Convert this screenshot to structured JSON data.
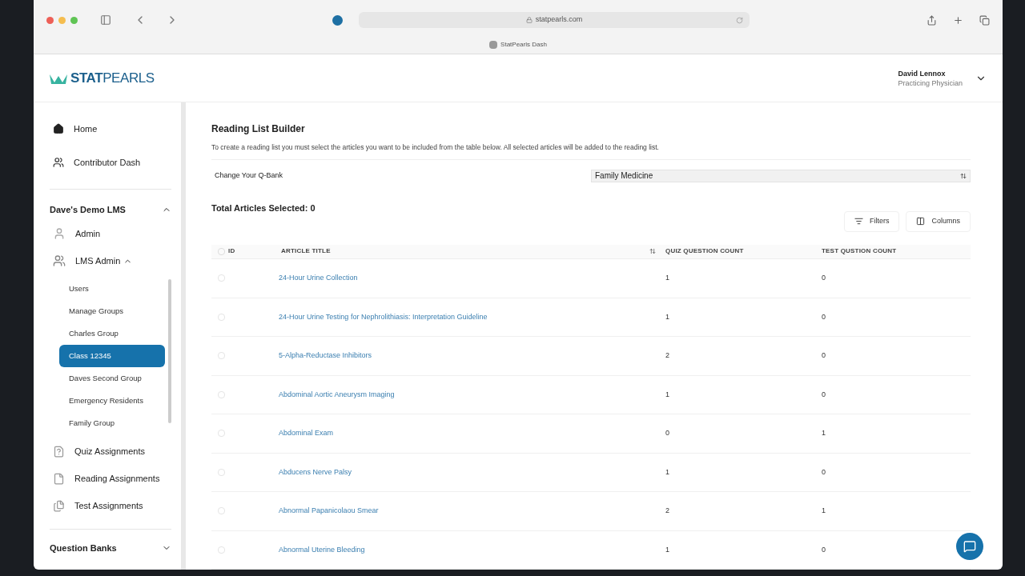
{
  "browser": {
    "address": "statpearls.com",
    "tab_title": "StatPearls Dash"
  },
  "header": {
    "logo_bold": "STAT",
    "logo_light": "PEARLS",
    "user_name": "David Lennox",
    "user_role": "Practicing Physician"
  },
  "sidebar": {
    "top_items": [
      {
        "label": "Home"
      },
      {
        "label": "Contributor Dash"
      }
    ],
    "section": {
      "title": "Dave's Demo LMS",
      "expanded": true,
      "items": [
        {
          "label": "Admin"
        },
        {
          "label": "LMS Admin",
          "expanded": true,
          "children": [
            {
              "label": "Users",
              "selected": false
            },
            {
              "label": "Manage Groups",
              "selected": false
            },
            {
              "label": "Charles Group",
              "selected": false
            },
            {
              "label": "Class 12345",
              "selected": true
            },
            {
              "label": "Daves Second Group",
              "selected": false
            },
            {
              "label": "Emergency Residents",
              "selected": false
            },
            {
              "label": "Family Group",
              "selected": false
            }
          ]
        },
        {
          "label": "Quiz Assignments"
        },
        {
          "label": "Reading Assignments"
        },
        {
          "label": "Test Assignments"
        }
      ]
    },
    "bottom_section": {
      "title": "Question Banks",
      "expanded": false
    }
  },
  "main": {
    "title": "Reading List Builder",
    "description": "To create a reading list you must select the articles you want to be included from the table below. All selected articles will be added to the reading list.",
    "qbank_label": "Change Your Q-Bank",
    "qbank_value": "Family Medicine",
    "total_selected": "Total Articles Selected: 0",
    "buttons": [
      "Filters",
      "Columns"
    ],
    "table": {
      "all_checked": false,
      "columns": [
        "ID",
        "ARTICLE TITLE",
        "QUIZ QUESTION COUNT",
        "TEST QUSTION COUNT"
      ],
      "rows": [
        {
          "checked": false,
          "title": "24-Hour Urine Collection",
          "quiz": "1",
          "test": "0"
        },
        {
          "checked": false,
          "title": "24-Hour Urine Testing for Nephrolithiasis: Interpretation Guideline",
          "quiz": "1",
          "test": "0"
        },
        {
          "checked": false,
          "title": "5-Alpha-Reductase Inhibitors",
          "quiz": "2",
          "test": "0"
        },
        {
          "checked": false,
          "title": "Abdominal Aortic Aneurysm Imaging",
          "quiz": "1",
          "test": "0"
        },
        {
          "checked": false,
          "title": "Abdominal Exam",
          "quiz": "0",
          "test": "1"
        },
        {
          "checked": false,
          "title": "Abducens Nerve Palsy",
          "quiz": "1",
          "test": "0"
        },
        {
          "checked": false,
          "title": "Abnormal Papanicolaou Smear",
          "quiz": "2",
          "test": "1"
        },
        {
          "checked": false,
          "title": "Abnormal Uterine Bleeding",
          "quiz": "1",
          "test": "0"
        }
      ]
    }
  }
}
